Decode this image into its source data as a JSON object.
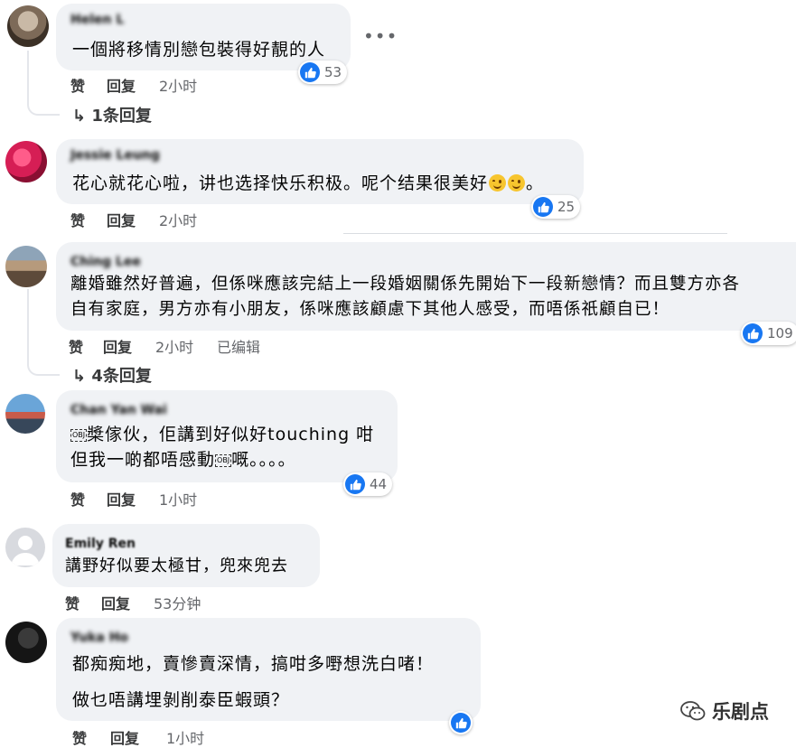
{
  "ui": {
    "like_label": "赞",
    "reply_label": "回复",
    "more_icon": "more-icon",
    "like_icon": "thumbs-up-icon",
    "colors": {
      "like_blue": "#1877f2",
      "bubble_bg": "#f0f2f5",
      "meta_grey": "#65676b"
    }
  },
  "comments": [
    {
      "author": "Helen L",
      "lines": [
        "一個將移情別戀包裝得好靚的人"
      ],
      "reactions": "53",
      "time": "2小时",
      "replies": "↳ 1条回复"
    },
    {
      "author": "Jessie Leung",
      "line1": "花心就花心啦，讲也选择快乐积极。呢个结果很美好",
      "line1_end": "。",
      "reactions": "25",
      "time": "2小时"
    },
    {
      "author": "Ching Lee",
      "lines": [
        "離婚雖然好普遍，但係咪應該完結上一段婚姻關係先開始下一段新戀情？而且雙方亦各",
        "自有家庭，男方亦有小朋友，係咪應該顧慮下其他人感受，而唔係祇顧自已！"
      ],
      "reactions": "109",
      "time": "2小时",
      "edited": "已编辑",
      "replies": "↳ 4条回复"
    },
    {
      "author": "Chan Yan Wai",
      "line1": "槳傢伙，佢講到好似好touching 咁",
      "line2a": "但我一啲都唔感動",
      "line2b": "嘅。。。。",
      "obj": "OBJ",
      "reactions": "44",
      "time": "1小时"
    },
    {
      "author": "Emily Ren",
      "lines": [
        "講野好似要太極甘，兜來兜去"
      ],
      "time": "53分钟"
    },
    {
      "author": "Yuka Ho",
      "lines": [
        "都痴痴地，賣慘賣深情，搞咁多嘢想洗白啫！",
        "做乜唔講埋剝削泰臣蝦頭？"
      ],
      "time": "1小时"
    }
  ],
  "watermark": {
    "text": "乐剧点"
  }
}
